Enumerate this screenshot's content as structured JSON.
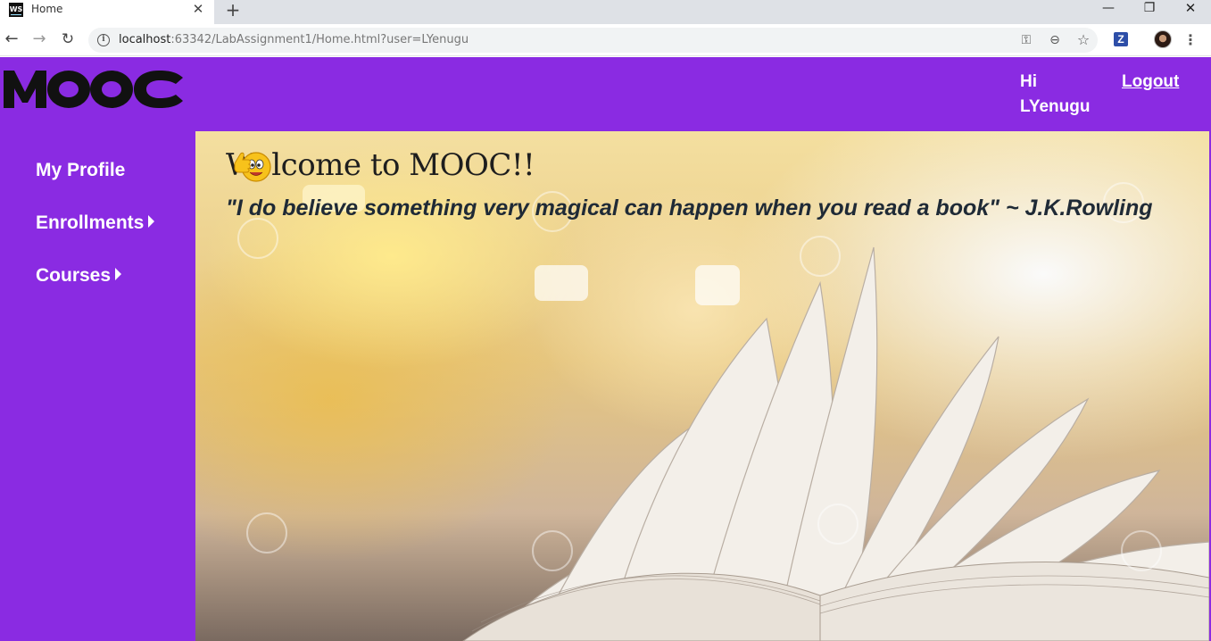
{
  "browser": {
    "tab_title": "Home",
    "favicon_text": "WS",
    "url_host": "localhost",
    "url_rest": ":63342/LabAssignment1/Home.html?user=LYenugu",
    "extension_label": "Z"
  },
  "header": {
    "logo_text": "MOOC",
    "greeting": "Hi LYenugu",
    "logout_label": "Logout"
  },
  "sidebar": {
    "items": [
      {
        "label": "My Profile",
        "has_submenu": false
      },
      {
        "label": "Enrollments",
        "has_submenu": true
      },
      {
        "label": "Courses",
        "has_submenu": true
      }
    ]
  },
  "main": {
    "welcome": "Welcome to MOOC!!",
    "quote": "\"I do believe something very magical can happen when you read a book\" ~ J.K.Rowling"
  },
  "colors": {
    "brand_purple": "#8a2be2",
    "logo": "#111111",
    "header_text": "#ffffff"
  },
  "icons": [
    "back-arrow-icon",
    "forward-arrow-icon",
    "reload-icon",
    "info-icon",
    "key-icon",
    "zoom-icon",
    "star-icon",
    "caret-right-icon",
    "thumbs-up-emoji-icon"
  ]
}
